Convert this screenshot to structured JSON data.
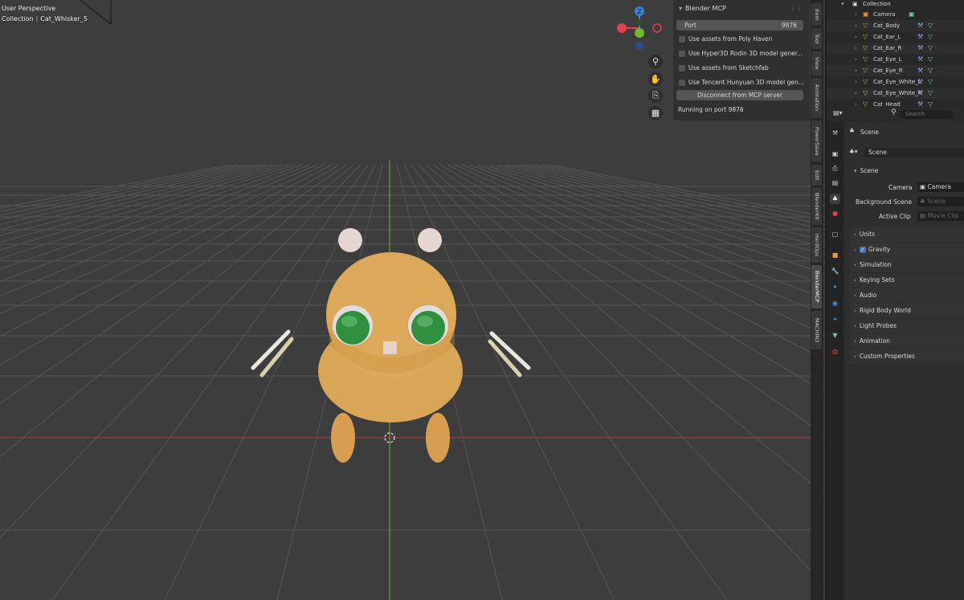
{
  "viewport": {
    "title": "User Perspective",
    "collection": "Collection",
    "active_object": "Cat_Whisker_5"
  },
  "gizmo": {
    "axis_x_color": "#e0424b",
    "axis_y_color": "#6fba2c",
    "axis_z_color": "#3b7fe0",
    "labels": [
      "Z",
      "X",
      "Y"
    ]
  },
  "nav_buttons": [
    "zoom-icon",
    "hand-pan-icon",
    "camera-icon",
    "grid-toggle-icon"
  ],
  "blender_mcp": {
    "panel_title": "Blender MCP",
    "port_label": "Port",
    "port_value": "9876",
    "options": [
      "Use assets from Poly Haven",
      "Use Hyper3D Rodin 3D model gener...",
      "Use assets from Sketchfab",
      "Use Tencent Hunyuan 3D model gen..."
    ],
    "disconnect_button": "Disconnect from MCP server",
    "status": "Running on port 9876"
  },
  "side_tabs": [
    "Item",
    "Tool",
    "View",
    "Animation",
    "PowerSave",
    "Edit",
    "BlenderKit",
    "HardOps",
    "BlenderMCP",
    "MACHIN3"
  ],
  "outliner": {
    "root": "Collection",
    "items": [
      {
        "name": "Camera",
        "type": "camera"
      },
      {
        "name": "Cat_Body",
        "type": "mesh"
      },
      {
        "name": "Cat_Ear_L",
        "type": "mesh"
      },
      {
        "name": "Cat_Ear_R",
        "type": "mesh"
      },
      {
        "name": "Cat_Eye_L",
        "type": "mesh"
      },
      {
        "name": "Cat_Eye_R",
        "type": "mesh"
      },
      {
        "name": "Cat_Eye_White_L",
        "type": "mesh"
      },
      {
        "name": "Cat_Eye_White_R",
        "type": "mesh"
      },
      {
        "name": "Cat_Head",
        "type": "mesh"
      }
    ]
  },
  "properties": {
    "search_placeholder": "Search",
    "breadcrumb": "Scene",
    "datablock": "Scene",
    "panel_title": "Scene",
    "camera_label": "Camera",
    "camera_value": "Camera",
    "background_scene_label": "Background Scene",
    "background_scene_value": "Scene",
    "active_clip_label": "Active Clip",
    "active_clip_value": "Movie Clip",
    "sections": [
      "Units",
      "Gravity",
      "Simulation",
      "Keying Sets",
      "Audio",
      "Rigid Body World",
      "Light Probes",
      "Animation",
      "Custom Properties"
    ]
  },
  "colors": {
    "cat_body": "#d9a556",
    "cat_eye_green": "#2f8f3d",
    "x_axis_line": "#9a3b3f",
    "y_axis_line": "#6b9a3a"
  }
}
